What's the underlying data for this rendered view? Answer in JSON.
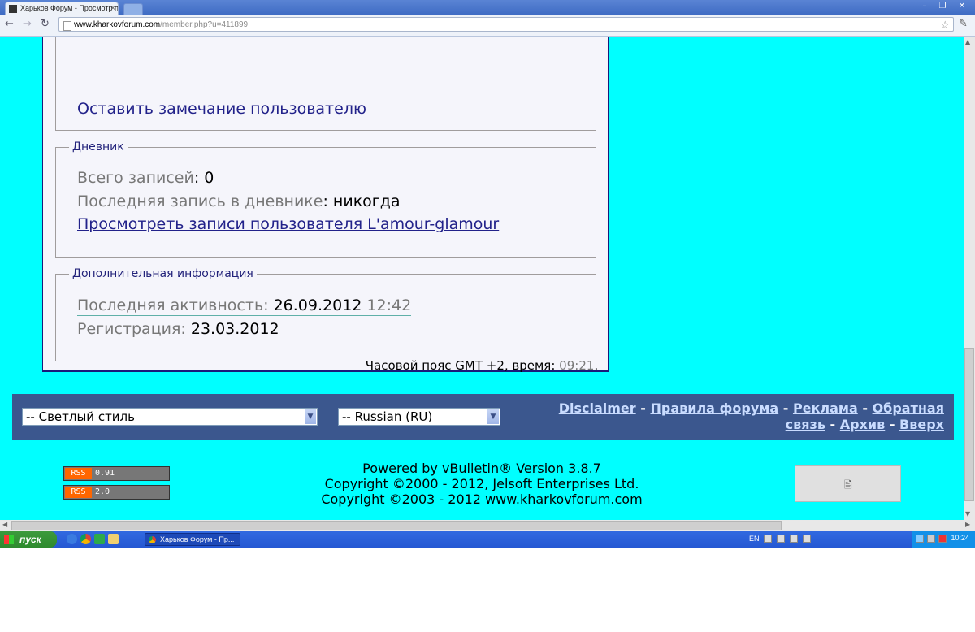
{
  "browser": {
    "tab_title": "Харьков Форум - Просмотр п",
    "url_domain": "www.kharkovforum.com",
    "url_path": "/member.php?u=411899"
  },
  "panel": {
    "top_link": "Оставить замечание пользователю",
    "diary": {
      "legend": "Дневник",
      "total_label": "Всего записей",
      "total_value": ": 0",
      "last_label": "Последняя запись в дневнике",
      "last_value": ": никогда",
      "view_link": "Просмотреть записи пользователя L'amour-glamour"
    },
    "extra": {
      "legend": "Дополнительная информация",
      "activity_label": "Последняя активность:",
      "activity_date": "26.09.2012",
      "activity_time": "12:42",
      "reg_label": "Регистрация:",
      "reg_value": "23.03.2012"
    }
  },
  "timezone": {
    "label": "Часовой пояс GMT +2, время:",
    "time": "09:21",
    "period": "."
  },
  "footer": {
    "style_select": "-- Светлый стиль",
    "lang_select": "-- Russian (RU)",
    "links": {
      "disclaimer": "Disclaimer",
      "rules": "Правила форума",
      "ads": "Реклама",
      "feedback": "Обратная связь",
      "archive": "Архив",
      "top": "Вверх"
    },
    "sep": "-"
  },
  "powered": {
    "line1": "Powered by vBulletin® Version 3.8.7",
    "line2": "Copyright ©2000 - 2012, Jelsoft Enterprises Ltd.",
    "line3": "Copyright ©2003 - 2012 www.kharkovforum.com"
  },
  "rss": [
    {
      "label": "RSS",
      "version": "0.91"
    },
    {
      "label": "RSS",
      "version": "2.0"
    }
  ],
  "taskbar": {
    "start_label": "пуск",
    "task_label": "Харьков Форум - Пр...",
    "lang": "EN",
    "clock": "10:24"
  },
  "colors": {
    "page_bg": "#00ffff",
    "panel_border": "#1a1a7a",
    "footer_bar": "#3b578e"
  }
}
